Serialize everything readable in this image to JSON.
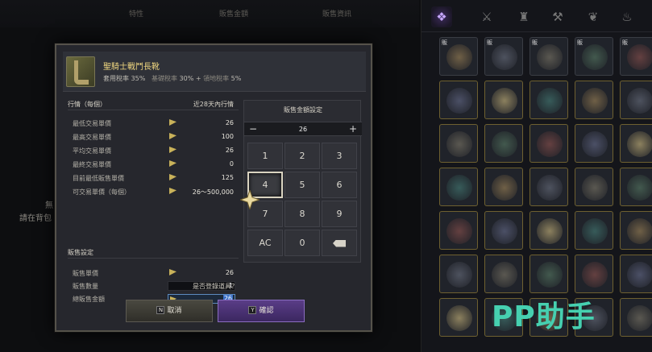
{
  "background": {
    "tabs": [
      "特性",
      "販售金額",
      "販售資訊"
    ],
    "left_text": [
      "無",
      "請在背包"
    ]
  },
  "inventory": {
    "categories": [
      "all-items-icon",
      "weapon-icon",
      "armor-icon",
      "anvil-icon",
      "herb-icon",
      "pouch-icon"
    ],
    "slot_tag": "販"
  },
  "dialog": {
    "item": {
      "name": "聖騎士戰鬥長靴",
      "tax_label": "套用稅率",
      "tax_value": "35%",
      "base_tax_label": "基礎稅率",
      "base_tax_value": "30% +",
      "region_tax_label": "領地稅率",
      "region_tax_value": "5%"
    },
    "market": {
      "header": "行情（每個）",
      "header_right": "近28天內行情",
      "rows": [
        {
          "label": "最低交易單價",
          "value": "26"
        },
        {
          "label": "最高交易單價",
          "value": "100"
        },
        {
          "label": "平均交易單價",
          "value": "26"
        },
        {
          "label": "最終交易單價",
          "value": "0"
        },
        {
          "label": "目前最低販售單價",
          "value": "125"
        },
        {
          "label": "可交易單價（每個）",
          "value": "26～500,000"
        }
      ]
    },
    "sale": {
      "header": "販售設定",
      "unit_price_label": "販售單價",
      "unit_price_value": "26",
      "qty_label": "販售數量",
      "qty_value": "1",
      "total_label": "總販售金額",
      "total_value": "26"
    },
    "keypad": {
      "title": "販售金額設定",
      "value": "26",
      "minus": "−",
      "plus": "+",
      "keys": [
        "1",
        "2",
        "3",
        "4",
        "5",
        "6",
        "7",
        "8",
        "9",
        "AC",
        "0"
      ]
    },
    "confirm_question": "是否登錄道具？",
    "cancel_hotkey": "N",
    "cancel_label": "取消",
    "ok_hotkey": "Y",
    "ok_label": "確認"
  },
  "watermark": "PP助手",
  "colors": {
    "item_name": "#f0d780",
    "confirm_button": "#5a3d87",
    "watermark": "#46d0b0"
  }
}
